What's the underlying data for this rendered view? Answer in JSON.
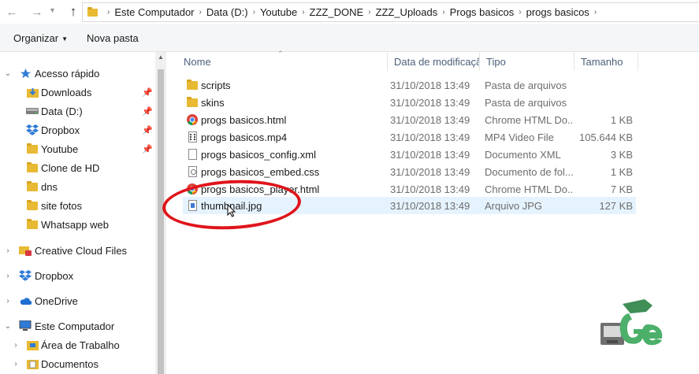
{
  "address_bar": {
    "breadcrumbs": [
      "Este Computador",
      "Data (D:)",
      "Youtube",
      "ZZZ_DONE",
      "ZZZ_Uploads",
      "Progs basicos",
      "progs basicos"
    ]
  },
  "ribbon": {
    "organize_label": "Organizar",
    "new_folder_label": "Nova pasta"
  },
  "nav_pane": {
    "quick_access": "Acesso rápido",
    "quick_items": [
      {
        "label": "Downloads",
        "icon": "download-folder-icon",
        "pinned": true
      },
      {
        "label": "Data (D:)",
        "icon": "drive-icon",
        "pinned": true
      },
      {
        "label": "Dropbox",
        "icon": "dropbox-icon",
        "pinned": true
      },
      {
        "label": "Youtube",
        "icon": "folder-icon",
        "pinned": true
      },
      {
        "label": "Clone de HD",
        "icon": "folder-icon",
        "pinned": false
      },
      {
        "label": "dns",
        "icon": "folder-icon",
        "pinned": false
      },
      {
        "label": "site fotos",
        "icon": "folder-icon",
        "pinned": false
      },
      {
        "label": "Whatsapp web",
        "icon": "folder-icon",
        "pinned": false
      }
    ],
    "creative_cloud": "Creative Cloud Files",
    "dropbox": "Dropbox",
    "onedrive": "OneDrive",
    "this_pc": "Este Computador",
    "pc_items": [
      "Área de Trabalho",
      "Documentos"
    ]
  },
  "file_list": {
    "columns": {
      "name": "Nome",
      "date": "Data de modificação",
      "type": "Tipo",
      "size": "Tamanho"
    },
    "rows": [
      {
        "name": "scripts",
        "date": "31/10/2018 13:49",
        "type": "Pasta de arquivos",
        "size": "",
        "icon": "folder-icon"
      },
      {
        "name": "skins",
        "date": "31/10/2018 13:49",
        "type": "Pasta de arquivos",
        "size": "",
        "icon": "folder-icon"
      },
      {
        "name": "progs basicos.html",
        "date": "31/10/2018 13:49",
        "type": "Chrome HTML Do...",
        "size": "1 KB",
        "icon": "chrome-icon"
      },
      {
        "name": "progs basicos.mp4",
        "date": "31/10/2018 13:49",
        "type": "MP4 Video File",
        "size": "105.644 KB",
        "icon": "video-file-icon"
      },
      {
        "name": "progs basicos_config.xml",
        "date": "31/10/2018 13:49",
        "type": "Documento XML",
        "size": "3 KB",
        "icon": "document-icon"
      },
      {
        "name": "progs basicos_embed.css",
        "date": "31/10/2018 13:49",
        "type": "Documento de fol...",
        "size": "1 KB",
        "icon": "stylesheet-icon"
      },
      {
        "name": "progs basicos_player.html",
        "date": "31/10/2018 13:49",
        "type": "Chrome HTML Do...",
        "size": "7 KB",
        "icon": "chrome-icon"
      },
      {
        "name": "thumbnail.jpg",
        "date": "31/10/2018 13:49",
        "type": "Arquivo JPG",
        "size": "127 KB",
        "icon": "image-file-icon",
        "selected": true
      }
    ]
  },
  "colors": {
    "selection": "#e5f3ff",
    "annotation": "#e0141b",
    "folder": "#e8b932",
    "logo_green": "#4caf6a"
  }
}
